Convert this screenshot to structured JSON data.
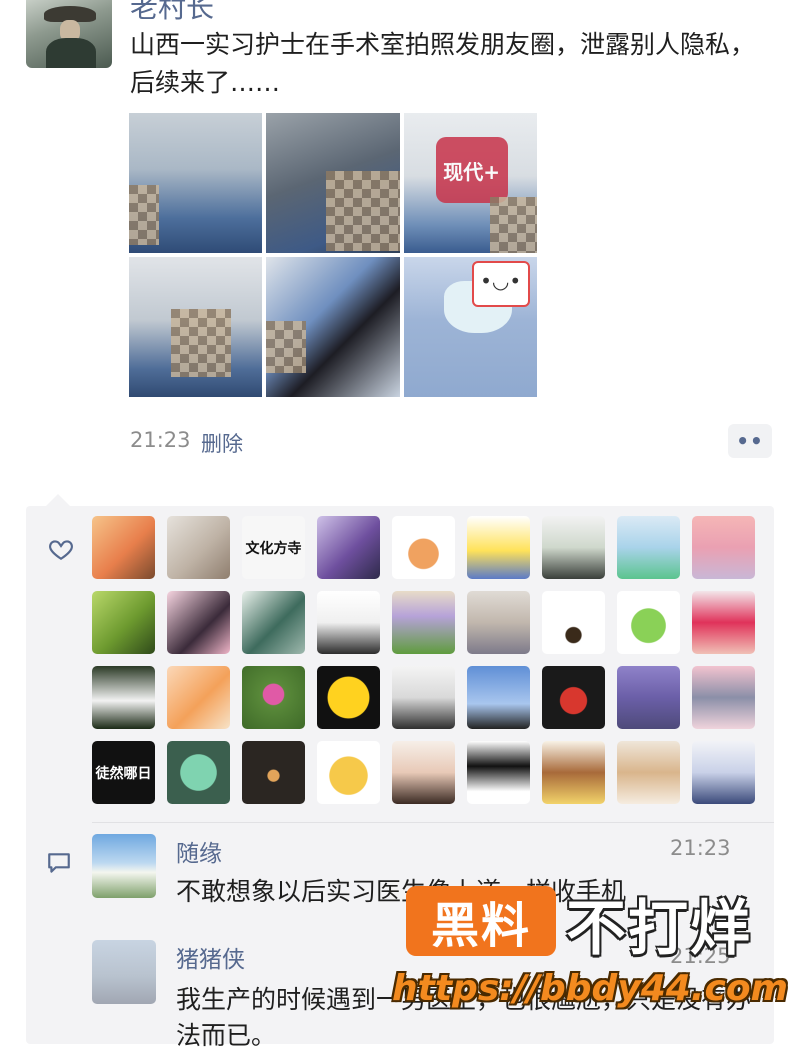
{
  "post": {
    "author": "老村长",
    "text": "山西一实习护士在手术室拍照发朋友圈，泄露别人隐私，后续来了……",
    "time": "21:23",
    "delete_label": "删除",
    "more_label": "••",
    "image_badges": {
      "modern": "现代+"
    }
  },
  "likes": {
    "icon": "heart-icon",
    "avatar_labels": [
      "文化方寺",
      "徒然哪日"
    ]
  },
  "comments": [
    {
      "author": "随缘",
      "time": "21:23",
      "text": "不敢想象以后实习医生像上道一样收手机"
    },
    {
      "author": "猪猪侠",
      "time": "21:25",
      "text": "我生产的时候遇到一男医生，也很尴尬，只是没有办法而已。"
    }
  ],
  "watermark": {
    "badge": "黑料",
    "slogan": "不打烊",
    "url": "https://bbdy44.com"
  },
  "colors": {
    "link": "#56698f",
    "panel_bg": "#f3f3f5",
    "watermark_orange": "#f1741d"
  }
}
